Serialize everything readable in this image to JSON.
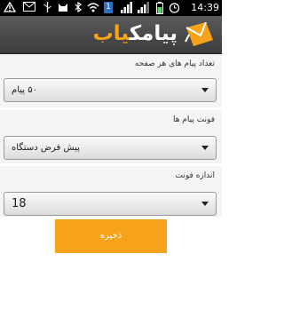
{
  "status_bar": {
    "time": "14:39",
    "notification_badge": "1"
  },
  "header": {
    "logo_main": "پیامک",
    "logo_accent": "یاب",
    "brand_color": "#f7a21b"
  },
  "settings": [
    {
      "label": "تعداد پیام های هر صفحه",
      "value": "۵۰ پیام"
    },
    {
      "label": "فونت پیام ها",
      "value": "پیش فرض دستگاه"
    },
    {
      "label": "اندازه فونت",
      "value": "18"
    }
  ],
  "save_button": {
    "label": "ذخیره"
  }
}
